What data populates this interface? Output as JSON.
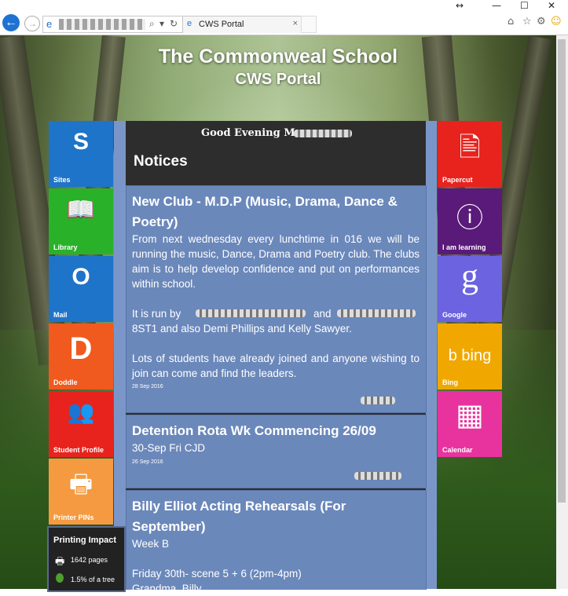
{
  "browser": {
    "tab_title": "CWS Portal",
    "back_glyph": "←",
    "forward_glyph": "→",
    "search_glyph": "⌕",
    "dropdown_glyph": "▾",
    "refresh_glyph": "↻",
    "close_glyph": "×",
    "minimize_glyph": "—",
    "maximize_glyph": "☐",
    "window_close_glyph": "✕",
    "resize_glyph": "↔",
    "home_glyph": "⌂",
    "favorites_glyph": "☆",
    "settings_glyph": "⚙",
    "feedback_glyph": "☺"
  },
  "site": {
    "title": "The Commonweal School",
    "subtitle": "CWS Portal",
    "greeting": "Good Evening Mr",
    "notices_heading": "Notices"
  },
  "left_tiles": [
    {
      "label": "Sites",
      "color": "#1e74c8",
      "icon": "sharepoint-icon",
      "glyph": "S"
    },
    {
      "label": "Library",
      "color": "#2ab12a",
      "icon": "book-icon",
      "glyph": "📖"
    },
    {
      "label": "Mail",
      "color": "#1e74c8",
      "icon": "outlook-icon",
      "glyph": "O"
    },
    {
      "label": "Doddle",
      "color": "#f05a1e",
      "icon": "doddle-icon",
      "glyph": "D"
    },
    {
      "label": "Student Profile",
      "color": "#e8231e",
      "icon": "people-icon",
      "glyph": "👥"
    },
    {
      "label": "Printer PINs",
      "color": "#f59a40",
      "icon": "printer-icon",
      "glyph": "🖶"
    }
  ],
  "right_tiles": [
    {
      "label": "Papercut",
      "color": "#e8231e",
      "icon": "papercut-icon",
      "glyph": "🖹"
    },
    {
      "label": "I am learning",
      "color": "#5a1a7a",
      "icon": "info-icon",
      "glyph": "ⓘ"
    },
    {
      "label": "Google",
      "color": "#6c63e0",
      "icon": "google-icon",
      "glyph": "g"
    },
    {
      "label": "Bing",
      "color": "#f0a800",
      "icon": "bing-icon",
      "glyph": "b bing"
    },
    {
      "label": "Calendar",
      "color": "#e8339e",
      "icon": "calendar-icon",
      "glyph": "▦"
    }
  ],
  "notices": [
    {
      "title_line1": "New Club - M.D.P (Music, Drama, Dance &",
      "title_line2": "Poetry)",
      "body1": "From next wednesday every lunchtime in 016 we will be running the music, Dance, Drama and Poetry club. The clubs aim is to help develop confidence and put on performances within school.",
      "body2a": "It is run by",
      "body2b": "and",
      "body2c": "8ST1 and also Demi Phillips and Kelly Sawyer.",
      "body3": "Lots of students have already joined and anyone wishing to join can come and find the leaders.",
      "date": "28 Sep 2016"
    },
    {
      "title_line1": "Detention Rota Wk Commencing 26/09",
      "body1": "30-Sep Fri CJD",
      "date": "26 Sep 2016"
    },
    {
      "title_line1": "Billy Elliot Acting Rehearsals (For",
      "title_line2": "September)",
      "body1": "Week B",
      "body2": "Friday 30th- scene 5 + 6 (2pm-4pm)",
      "body3": "Grandma, Billy"
    }
  ],
  "printing_impact": {
    "title": "Printing Impact",
    "pages": "1642 pages",
    "tree": "1.5% of a tree"
  }
}
